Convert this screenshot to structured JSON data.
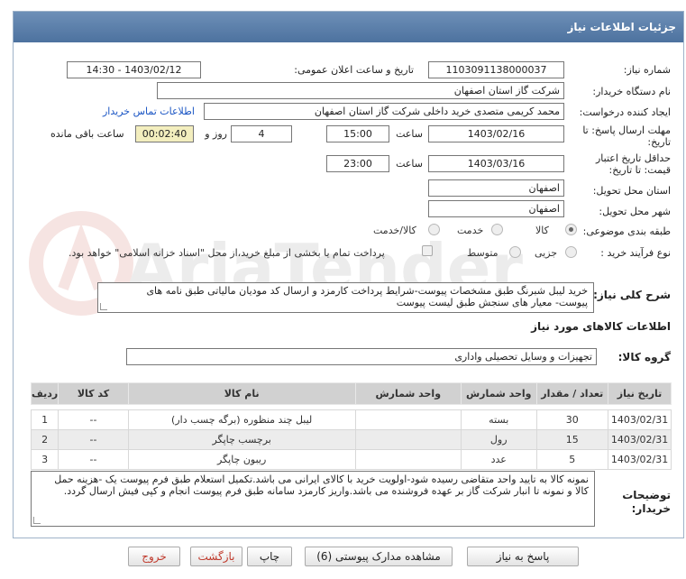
{
  "panel": {
    "title": "جزئیات اطلاعات نیاز"
  },
  "fields": {
    "need_number_label": "شماره نیاز:",
    "need_number": "1103091138000037",
    "announce_label": "تاریخ و ساعت اعلان عمومی:",
    "announce_value": "1403/02/12 - 14:30",
    "buyer_org_label": "نام دستگاه خریدار:",
    "buyer_org": "شرکت گاز استان اصفهان",
    "creator_label": "ایجاد کننده درخواست:",
    "creator": "محمد کریمی متصدی خرید داخلی شرکت گاز استان اصفهان",
    "contact_link": "اطلاعات تماس خریدار",
    "reply_deadline_label_1": "مهلت ارسال پاسخ: تا",
    "reply_deadline_label_2": "تاریخ:",
    "reply_date": "1403/02/16",
    "time_label": "ساعت",
    "reply_time": "15:00",
    "days_value": "4",
    "days_label": "روز و",
    "remaining_time": "00:02:40",
    "remaining_label": "ساعت باقی مانده",
    "price_validity_label_1": "حداقل تاریخ اعتبار",
    "price_validity_label_2": "قیمت: تا تاریخ:",
    "validity_date": "1403/03/16",
    "validity_time": "23:00",
    "province_label": "استان محل تحویل:",
    "province": "اصفهان",
    "city_label": "شهر محل تحویل:",
    "city": "اصفهان",
    "category_label": "طبقه بندی موضوعی:",
    "category_options": [
      "کالا",
      "خدمت",
      "کالا/خدمت"
    ],
    "process_label": "نوع فرآیند خرید :",
    "process_options": [
      "جزیی",
      "متوسط"
    ],
    "payment_note": "پرداخت تمام یا بخشی از مبلغ خرید،از محل \"اسناد خزانه اسلامی\" خواهد بود."
  },
  "summary": {
    "label": "شرح کلی نیاز:",
    "text": "خرید لیبل شبرنگ طبق مشخصات پیوست-شرایط پرداخت کارمزد و ارسال کد مودیان مالیاتی طبق نامه های پیوست- معیار های سنجش طبق لیست پیوست"
  },
  "goods": {
    "section_title": "اطلاعات کالاهای مورد نیاز",
    "group_label": "گروه کالا:",
    "group_value": "تجهیزات و وسایل تحصیلی واداری"
  },
  "table": {
    "headers": [
      "ردیف",
      "کد کالا",
      "نام کالا",
      "واحد شمارش",
      "تعداد / مقدار",
      "تاریخ نیاز"
    ],
    "rows": [
      [
        "1",
        "--",
        "لیبل چند منظوره (برگه چسب دار)",
        "بسته",
        "30",
        "1403/02/31"
      ],
      [
        "2",
        "--",
        "برچسب چاپگر",
        "رول",
        "15",
        "1403/02/31"
      ],
      [
        "3",
        "--",
        "ریبون چاپگر",
        "عدد",
        "5",
        "1403/02/31"
      ]
    ]
  },
  "buyer_notes": {
    "label_1": "توضیحات",
    "label_2": "خریدار:",
    "text": "نمونه کالا به تایید واحد متقاضی رسیده شود-اولویت خرید با کالای ایرانی می باشد.تکمیل استعلام طبق فرم پیوست یک -هزینه حمل کالا و نمونه تا انبار شرکت گاز بر عهده فروشنده می باشد.واریز کارمزد سامانه طبق فرم پیوست انجام و کپی فیش ارسال گردد."
  },
  "buttons": {
    "reply": "پاسخ به نیاز",
    "attachments": "مشاهده مدارک پیوستی (6)",
    "print": "چاپ",
    "back": "بازگشت",
    "exit": "خروج"
  },
  "colors": {
    "header": "#5a7ca8",
    "highlight": "#f3eebe",
    "link": "#1a55c4",
    "exit_text": "#c0392b"
  }
}
